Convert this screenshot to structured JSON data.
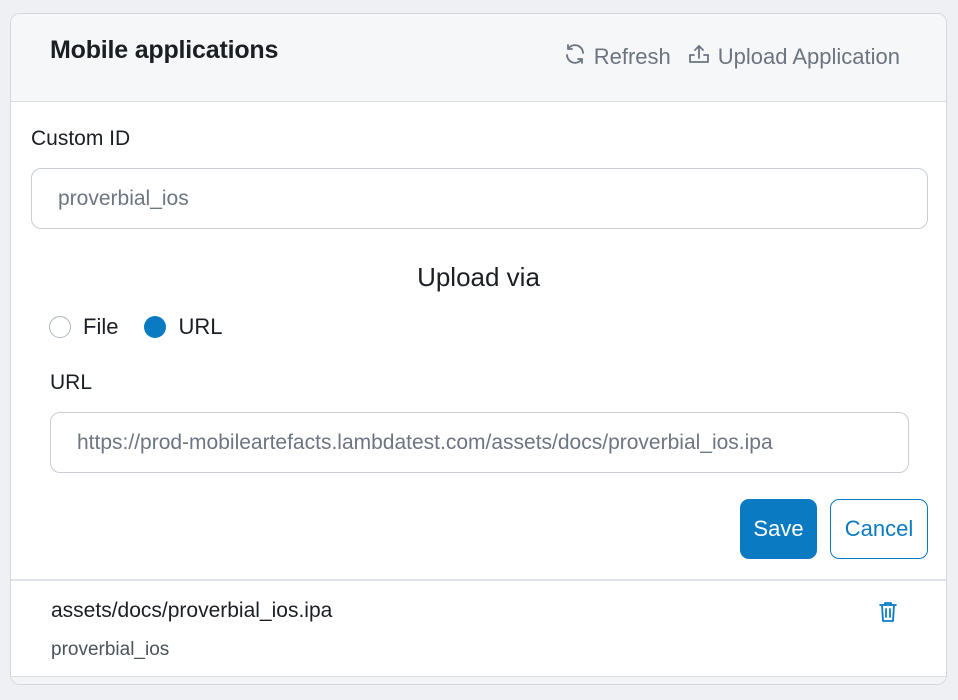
{
  "header": {
    "title": "Mobile applications",
    "refresh_label": "Refresh",
    "upload_label": "Upload Application",
    "refresh_icon": "refresh-icon",
    "upload_icon": "upload-icon"
  },
  "form": {
    "custom_id_label": "Custom ID",
    "custom_id_value": "proverbial_ios",
    "upload_via_heading": "Upload via",
    "radio_options": [
      {
        "label": "File",
        "checked": false
      },
      {
        "label": "URL",
        "checked": true
      }
    ],
    "url_label": "URL",
    "url_value": "https://prod-mobileartefacts.lambdatest.com/assets/docs/proverbial_ios.ipa",
    "save_label": "Save",
    "cancel_label": "Cancel"
  },
  "files": [
    {
      "name": "assets/docs/proverbial_ios.ipa",
      "custom_id": "proverbial_ios",
      "action_icon": "trash-icon"
    }
  ],
  "colors": {
    "accent": "#0a7bc2",
    "muted_text": "#6b7480",
    "header_bg": "#f6f7f9"
  }
}
